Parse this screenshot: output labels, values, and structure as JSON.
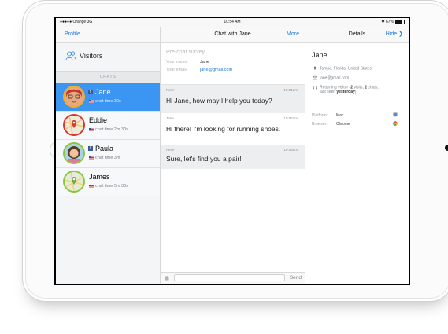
{
  "status_bar": {
    "carrier": "●●●●● Orange",
    "network": "3G",
    "time": "10:54 AM",
    "battery": "67%"
  },
  "left_pane": {
    "profile_button": "Profile",
    "visitors_label": "Visitors",
    "chats_header": "CHATS",
    "chats": [
      {
        "name": "Jane",
        "meta": "chat time 30s",
        "facebook": true,
        "active": true
      },
      {
        "name": "Eddie",
        "meta": "chat time 2m 30s",
        "facebook": false,
        "active": false
      },
      {
        "name": "Paula",
        "meta": "chat time 3m",
        "facebook": true,
        "active": false
      },
      {
        "name": "James",
        "meta": "chat time 5m 30s",
        "facebook": false,
        "active": false
      }
    ],
    "fb_glyph": "f"
  },
  "middle_pane": {
    "title": "Chat with Jane",
    "more_button": "More",
    "survey": {
      "title": "Pre-chat survey",
      "name_label": "Your name:",
      "name_value": "Jane",
      "email_label": "Your email:",
      "email_value": "jane@gmail.com"
    },
    "messages": [
      {
        "sender": "Peter",
        "time": "10:01am",
        "text": "Hi Jane, how may I help you today?"
      },
      {
        "sender": "Jane",
        "time": "10:02am",
        "text": "Hi there! I'm looking for running shoes."
      },
      {
        "sender": "Peter",
        "time": "10:03am",
        "text": "Sure, let's find you a pair!"
      }
    ],
    "send_button": "Send"
  },
  "right_pane": {
    "title": "Details",
    "hide_button": "Hide",
    "hide_chevron": "❯",
    "visitor_name": "Jane",
    "location": "Tampa, Florida, United States",
    "email": "jane@gmail.com",
    "returning_prefix": "Returning visitor (",
    "visits": "2",
    "visits_suffix": " visits, ",
    "chats": "2",
    "chats_suffix": " chats,",
    "last_seen_prefix": "last seen ",
    "last_seen": "yesterday",
    "last_seen_suffix": ")",
    "platform_label": "Platform:",
    "platform_value": "Mac",
    "browser_label": "Browser:",
    "browser_value": "Chrome"
  },
  "colors": {
    "accent": "#1e7ae0",
    "active_chat": "#3a95f3",
    "facebook": "#3b5998"
  }
}
